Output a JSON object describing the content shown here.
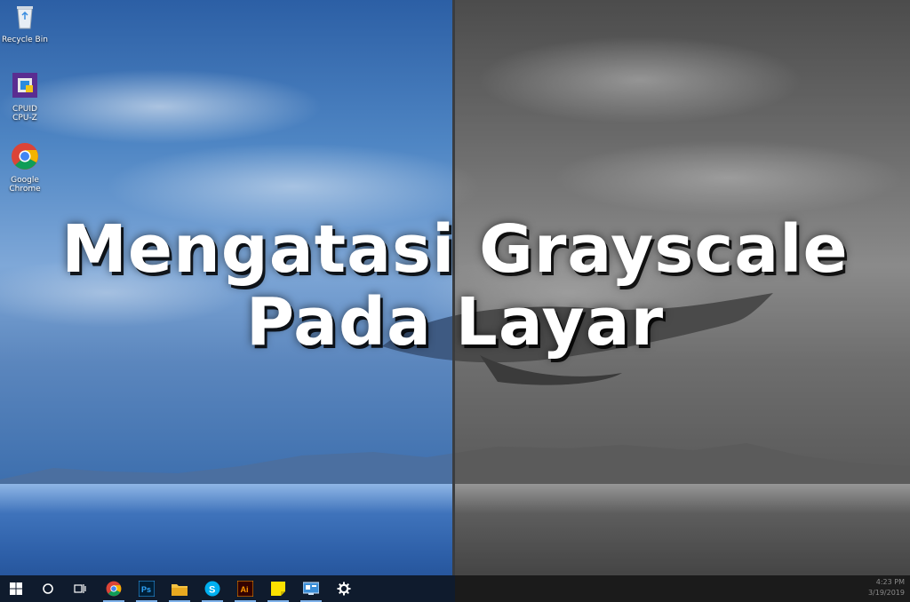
{
  "desktop": {
    "icons": [
      {
        "label_line1": "Recycle Bin",
        "label_line2": "",
        "icon": "recycle-bin-icon"
      },
      {
        "label_line1": "CPUID",
        "label_line2": "CPU-Z",
        "icon": "cpuz-icon"
      },
      {
        "label_line1": "Google",
        "label_line2": "Chrome",
        "icon": "chrome-icon"
      }
    ]
  },
  "overlay": {
    "title_line1": "Mengatasi Grayscale",
    "title_line2": "Pada Layar"
  },
  "taskbar": {
    "items": [
      "windows-start-icon",
      "cortana-search-icon",
      "task-view-icon",
      "chrome-icon",
      "photoshop-icon",
      "file-explorer-icon",
      "skype-icon",
      "illustrator-icon",
      "sticky-notes-icon",
      "control-panel-icon",
      "settings-gear-icon"
    ],
    "clock_time": "4:23 PM",
    "clock_date": "3/19/2019"
  },
  "colors": {
    "taskbar_color": "#0f1b2d",
    "taskbar_gray": "#1b1b1b",
    "accent_blue": "#2d6fbf"
  }
}
